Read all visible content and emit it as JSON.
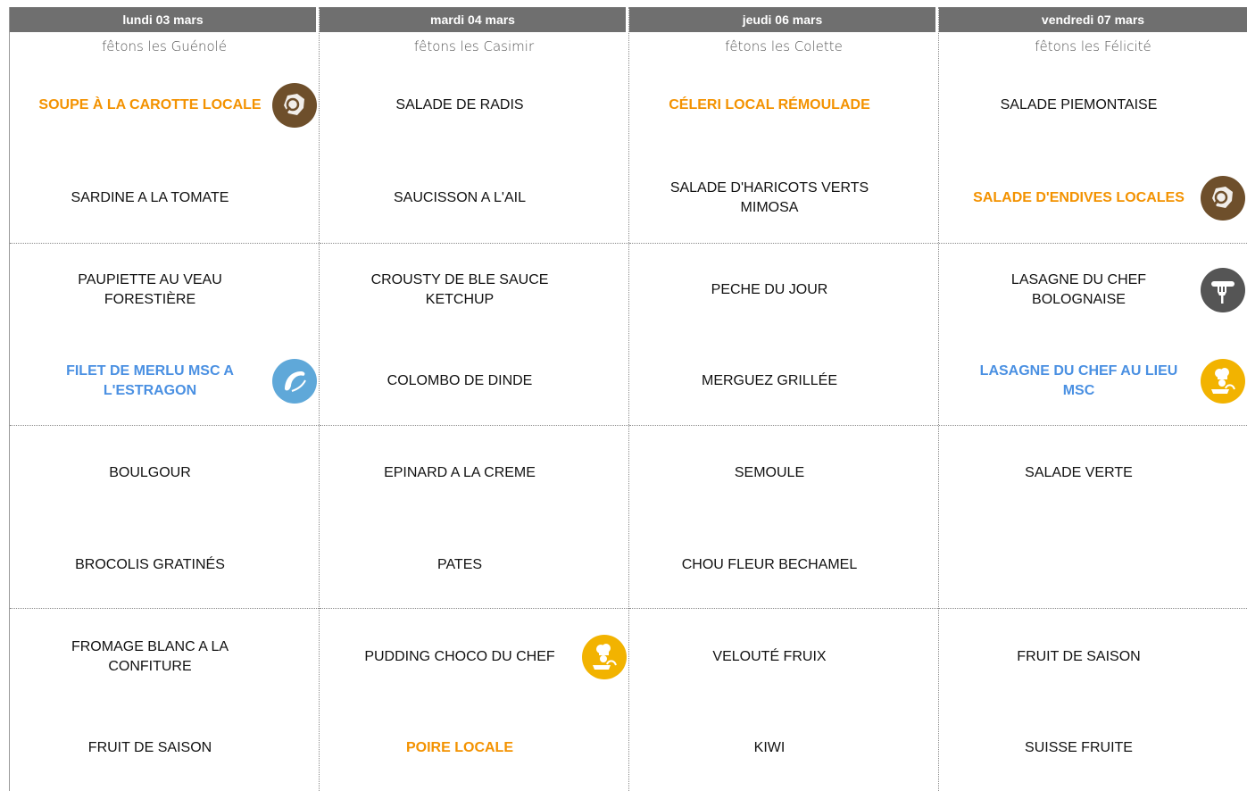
{
  "days": [
    {
      "header": "lundi 03 mars",
      "fete": "fêtons les Guénolé",
      "items": [
        {
          "label": "SOUPE À LA CAROTTE LOCALE",
          "style": "orange",
          "icon": "local-produce-icon"
        },
        {
          "label": "SARDINE A LA TOMATE",
          "style": "normal",
          "icon": ""
        },
        {
          "label": "PAUPIETTE AU VEAU FORESTIÈRE",
          "style": "normal",
          "icon": ""
        },
        {
          "label": "FILET DE MERLU MSC A L'ESTRAGON",
          "style": "blue",
          "icon": "sustainable-fishing-icon"
        },
        {
          "label": "BOULGOUR",
          "style": "normal",
          "icon": ""
        },
        {
          "label": "BROCOLIS GRATINÉS",
          "style": "normal",
          "icon": ""
        },
        {
          "label": "FROMAGE BLANC A LA CONFITURE",
          "style": "normal",
          "icon": ""
        },
        {
          "label": "FRUIT DE SAISON",
          "style": "normal",
          "icon": ""
        }
      ]
    },
    {
      "header": "mardi 04 mars",
      "fete": "fêtons les Casimir",
      "items": [
        {
          "label": "SALADE DE RADIS",
          "style": "normal",
          "icon": ""
        },
        {
          "label": "SAUCISSON A L'AIL",
          "style": "normal",
          "icon": ""
        },
        {
          "label": "CROUSTY DE BLE SAUCE KETCHUP",
          "style": "normal",
          "icon": ""
        },
        {
          "label": "COLOMBO DE DINDE",
          "style": "normal",
          "icon": ""
        },
        {
          "label": "EPINARD A LA CREME",
          "style": "normal",
          "icon": ""
        },
        {
          "label": "PATES",
          "style": "normal",
          "icon": ""
        },
        {
          "label": "PUDDING CHOCO DU CHEF",
          "style": "normal",
          "icon": "chef-homemade-icon"
        },
        {
          "label": "POIRE LOCALE",
          "style": "orange",
          "icon": ""
        }
      ]
    },
    {
      "header": "jeudi 06 mars",
      "fete": "fêtons les Colette",
      "items": [
        {
          "label": "CÉLERI LOCAL RÉMOULADE",
          "style": "orange",
          "icon": ""
        },
        {
          "label": "SALADE D'HARICOTS VERTS MIMOSA",
          "style": "normal",
          "icon": ""
        },
        {
          "label": "PECHE DU JOUR",
          "style": "normal",
          "icon": ""
        },
        {
          "label": "MERGUEZ GRILLÉE",
          "style": "normal",
          "icon": ""
        },
        {
          "label": "SEMOULE",
          "style": "normal",
          "icon": ""
        },
        {
          "label": "CHOU FLEUR BECHAMEL",
          "style": "normal",
          "icon": ""
        },
        {
          "label": "VELOUTÉ FRUIX",
          "style": "normal",
          "icon": ""
        },
        {
          "label": "KIWI",
          "style": "normal",
          "icon": ""
        }
      ]
    },
    {
      "header": "vendredi 07 mars",
      "fete": "fêtons les Félicité",
      "items": [
        {
          "label": "SALADE PIEMONTAISE",
          "style": "normal",
          "icon": ""
        },
        {
          "label": "SALADE D'ENDIVES LOCALES",
          "style": "orange",
          "icon": "local-produce-icon"
        },
        {
          "label": "LASAGNE DU CHEF BOLOGNAISE",
          "style": "normal",
          "icon": "meat-fork-icon"
        },
        {
          "label": "LASAGNE DU CHEF AU LIEU MSC",
          "style": "blue",
          "icon": "chef-homemade-icon"
        },
        {
          "label": "SALADE VERTE",
          "style": "normal",
          "icon": ""
        },
        {
          "label": "",
          "style": "normal",
          "icon": ""
        },
        {
          "label": "FRUIT DE SAISON",
          "style": "normal",
          "icon": ""
        },
        {
          "label": "SUISSE FRUITE",
          "style": "normal",
          "icon": ""
        }
      ]
    }
  ],
  "colors": {
    "header_bg": "#6f6f6f",
    "local": "#f39200",
    "sustainable": "#4a90e2",
    "local_icon": "#6e4f2b",
    "fish_icon": "#5fa8d9",
    "chef_icon": "#f2b300",
    "meat_icon": "#555555"
  }
}
